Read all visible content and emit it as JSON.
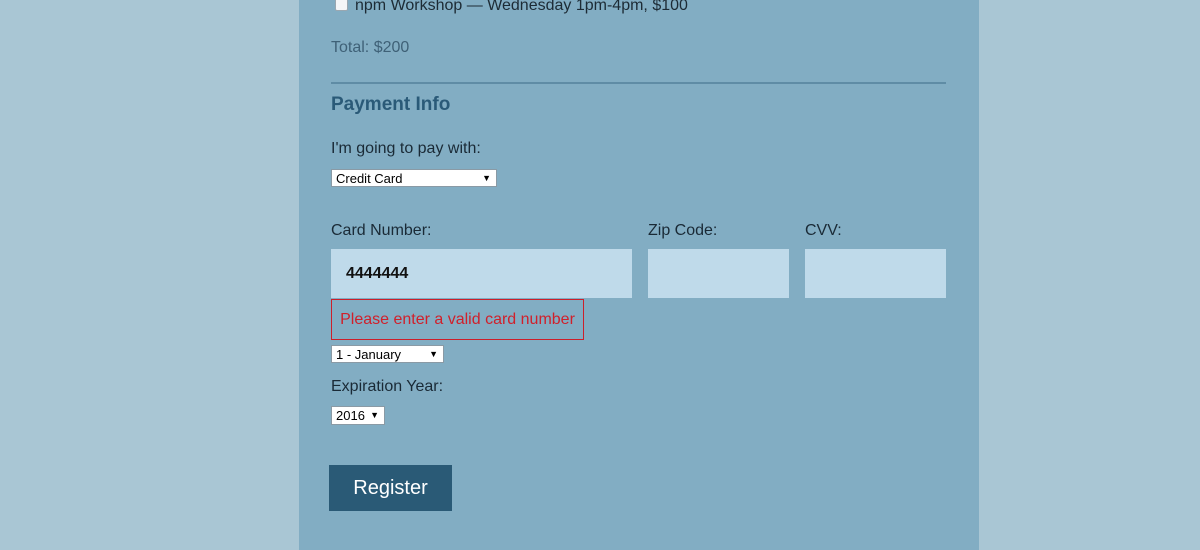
{
  "activities": {
    "npm_workshop_label": "npm Workshop — Wednesday 1pm-4pm, $100",
    "npm_workshop_checked": false,
    "total": "Total: $200"
  },
  "payment": {
    "section_title": "Payment Info",
    "pay_with_label": "I'm going to pay with:",
    "pay_with_selected": "Credit Card",
    "card_number_label": "Card Number:",
    "card_number_value": "4444444",
    "zip_label": "Zip Code:",
    "zip_value": "",
    "cvv_label": "CVV:",
    "cvv_value": "",
    "error_message": "Please enter a valid card number",
    "exp_month_selected": "1 - January",
    "exp_year_label": "Expiration Year:",
    "exp_year_selected": "2016"
  },
  "actions": {
    "register_label": "Register"
  },
  "colors": {
    "page_background": "#a9c6d4",
    "panel_background": "#82adc3",
    "input_background": "#bfdaea",
    "error_red": "#d0202b",
    "button_background": "#2a5a76",
    "heading_color": "#2a5a78"
  },
  "icons": {
    "select_arrow": "dropdown-arrow-icon"
  }
}
